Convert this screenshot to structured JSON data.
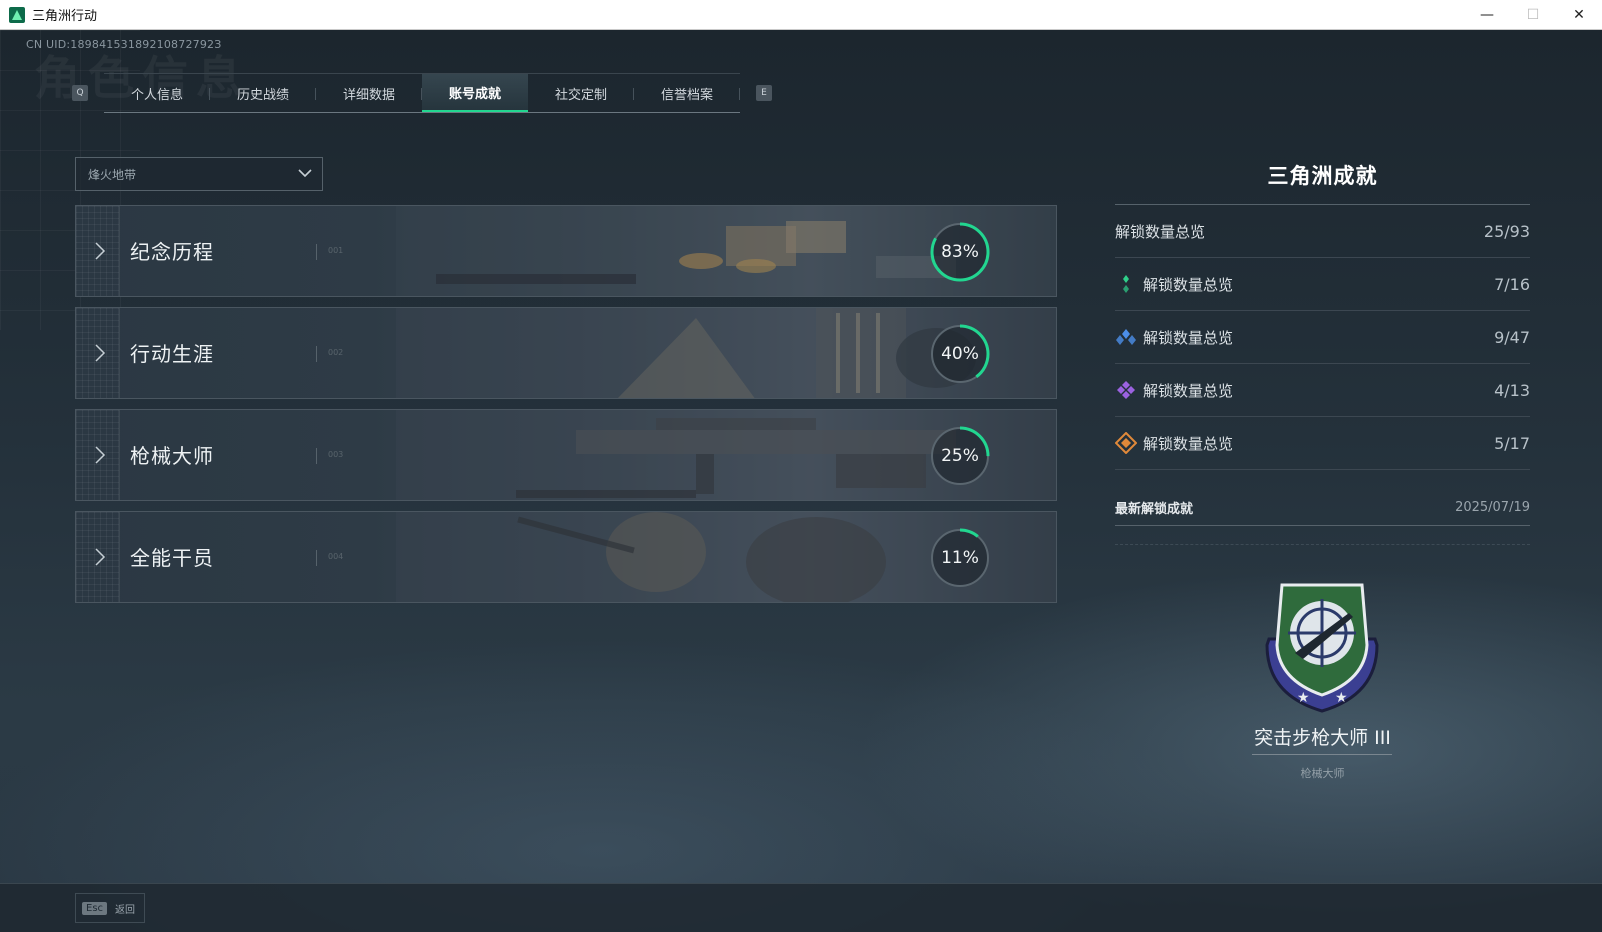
{
  "window": {
    "title": "三角洲行动",
    "minimize": "—",
    "maximize": "☐",
    "close": "✕"
  },
  "uid": "CN UID:18984153189210872792З",
  "ghost_title": "角色信息",
  "tabs": {
    "prev_key": "Q",
    "next_key": "E",
    "items": [
      {
        "label": "个人信息",
        "active": false
      },
      {
        "label": "历史战绩",
        "active": false
      },
      {
        "label": "详细数据",
        "active": false
      },
      {
        "label": "账号成就",
        "active": true
      },
      {
        "label": "社交定制",
        "active": false
      },
      {
        "label": "信誉档案",
        "active": false
      }
    ]
  },
  "mode_select": {
    "value": "烽火地带"
  },
  "categories": [
    {
      "label": "纪念历程",
      "code": "001",
      "progress": 0.83,
      "pct_text": "83%"
    },
    {
      "label": "行动生涯",
      "code": "002",
      "progress": 0.4,
      "pct_text": "40%"
    },
    {
      "label": "枪械大师",
      "code": "003",
      "progress": 0.25,
      "pct_text": "25%"
    },
    {
      "label": "全能干员",
      "code": "004",
      "progress": 0.11,
      "pct_text": "11%"
    }
  ],
  "summary": {
    "title": "三角洲成就",
    "total": {
      "label": "解锁数量总览",
      "value": "25/93"
    },
    "tiers": [
      {
        "icon": "green-diamond-icon",
        "color": "#2fd08a",
        "label": "解锁数量总览",
        "value": "7/16"
      },
      {
        "icon": "blue-diamond-icon",
        "color": "#4c8ee8",
        "label": "解锁数量总览",
        "value": "9/47"
      },
      {
        "icon": "purple-diamond-icon",
        "color": "#9b62e0",
        "label": "解锁数量总览",
        "value": "4/13"
      },
      {
        "icon": "orange-diamond-icon",
        "color": "#e0893a",
        "label": "解锁数量总览",
        "value": "5/17"
      }
    ]
  },
  "latest": {
    "label": "最新解锁成就",
    "date": "2025/07/19",
    "badge_name": "突击步枪大师 III",
    "badge_category": "枪械大师"
  },
  "bottom": {
    "esc_key": "Esc",
    "esc_label": "返回"
  },
  "colors": {
    "accent": "#22d690",
    "ring_track": "#5a666f"
  }
}
